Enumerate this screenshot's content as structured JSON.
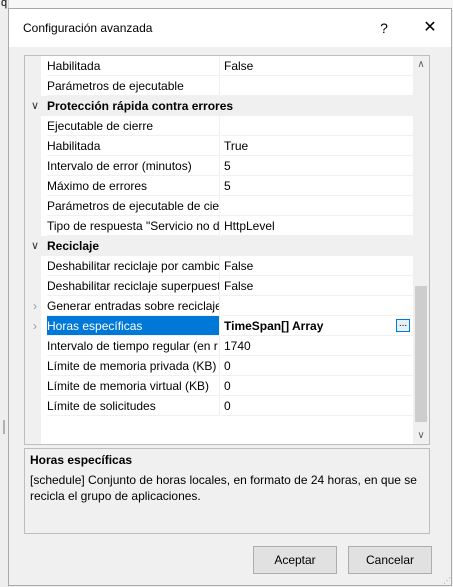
{
  "backdrop": {
    "letter": "q"
  },
  "dialog": {
    "title": "Configuración avanzada",
    "help_label": "?",
    "close_label": "✕"
  },
  "property_grid": {
    "rows": [
      {
        "type": "property",
        "name": "Habilitada",
        "value": "False"
      },
      {
        "type": "property",
        "name": "Parámetros de ejecutable",
        "value": ""
      },
      {
        "type": "category",
        "name": "Protección rápida contra errores",
        "chevron": "∨"
      },
      {
        "type": "property",
        "name": "Ejecutable de cierre",
        "value": ""
      },
      {
        "type": "property",
        "name": "Habilitada",
        "value": "True"
      },
      {
        "type": "property",
        "name": "Intervalo de error (minutos)",
        "value": "5"
      },
      {
        "type": "property",
        "name": "Máximo de errores",
        "value": "5"
      },
      {
        "type": "property",
        "name": "Parámetros de ejecutable de cier",
        "value": ""
      },
      {
        "type": "property",
        "name": "Tipo de respuesta \"Servicio no d",
        "value": "HttpLevel"
      },
      {
        "type": "category",
        "name": "Reciclaje",
        "chevron": "∨"
      },
      {
        "type": "property",
        "name": "Deshabilitar reciclaje por cambic",
        "value": "False"
      },
      {
        "type": "property",
        "name": "Deshabilitar reciclaje superpuest",
        "value": "False"
      },
      {
        "type": "expandable",
        "name": "Generar entradas sobre reciclaje",
        "value": "",
        "chevron": "›"
      },
      {
        "type": "expandable",
        "name": "Horas específicas",
        "value": "TimeSpan[] Array",
        "chevron": "›",
        "selected": true,
        "button": "..."
      },
      {
        "type": "property",
        "name": "Intervalo de tiempo regular (en r",
        "value": "1740"
      },
      {
        "type": "property",
        "name": "Límite de memoria privada (KB)",
        "value": "0"
      },
      {
        "type": "property",
        "name": "Límite de memoria virtual (KB)",
        "value": "0"
      },
      {
        "type": "property",
        "name": "Límite de solicitudes",
        "value": "0"
      }
    ],
    "scroll_up": "∧",
    "scroll_down": "∨"
  },
  "description": {
    "title": "Horas específicas",
    "text": "[schedule] Conjunto de horas locales, en formato de 24 horas, en que se recicla el grupo de aplicaciones."
  },
  "buttons": {
    "accept": "Aceptar",
    "cancel": "Cancelar"
  }
}
